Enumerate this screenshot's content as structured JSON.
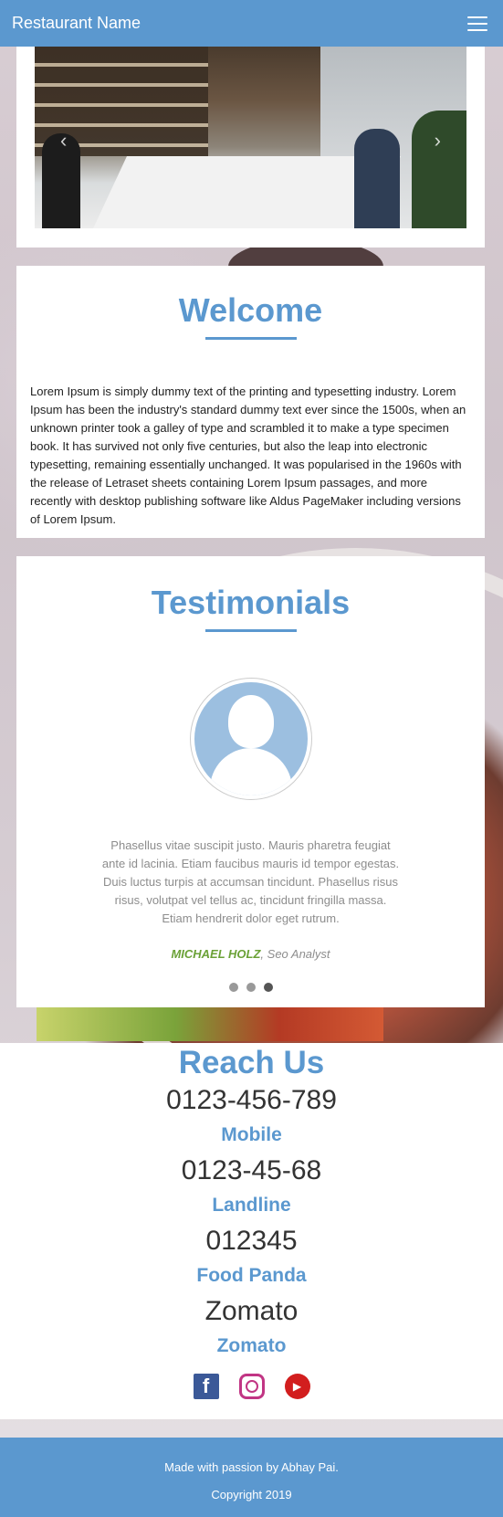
{
  "nav": {
    "brand": "Restaurant Name"
  },
  "carousel": {
    "prev": "‹",
    "next": "›"
  },
  "welcome": {
    "title": "Welcome",
    "text": "Lorem Ipsum is simply dummy text of the printing and typesetting industry. Lorem Ipsum has been the industry's standard dummy text ever since the 1500s, when an unknown printer took a galley of type and scrambled it to make a type specimen book. It has survived not only five centuries, but also the leap into electronic typesetting, remaining essentially unchanged. It was popularised in the 1960s with the release of Letraset sheets containing Lorem Ipsum passages, and more recently with desktop publishing software like Aldus PageMaker including versions of Lorem Ipsum."
  },
  "testimonials": {
    "title": "Testimonials",
    "quote": "Phasellus vitae suscipit justo. Mauris pharetra feugiat ante id lacinia. Etiam faucibus mauris id tempor egestas. Duis luctus turpis at accumsan tincidunt. Phasellus risus risus, volutpat vel tellus ac, tincidunt fringilla massa. Etiam hendrerit dolor eget rutrum.",
    "author_name": "MICHAEL HOLZ",
    "author_role": ", Seo Analyst"
  },
  "reach": {
    "title": "Reach Us",
    "contacts": [
      {
        "value": "0123-456-789",
        "label": "Mobile"
      },
      {
        "value": "0123-45-68",
        "label": "Landline"
      },
      {
        "value": "012345",
        "label": "Food Panda"
      },
      {
        "value": "Zomato",
        "label": "Zomato"
      }
    ],
    "socials": [
      "facebook-icon",
      "instagram-icon",
      "youtube-icon"
    ]
  },
  "footer": {
    "credit": "Made with passion by Abhay Pai.",
    "copyright": "Copyright 2019"
  },
  "colors": {
    "primary": "#5b98cf",
    "author": "#6aa136"
  }
}
